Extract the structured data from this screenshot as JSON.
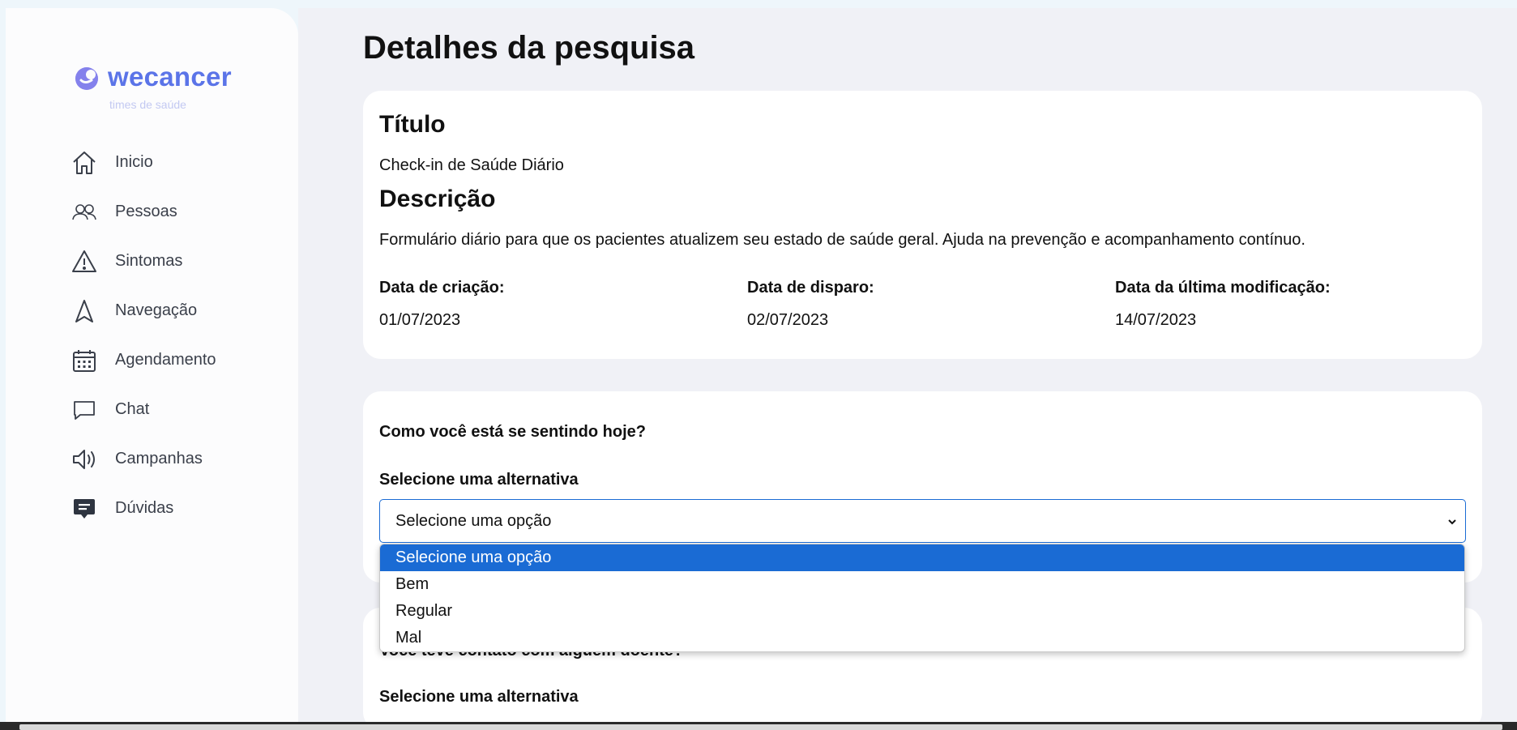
{
  "brand": {
    "name": "wecancer",
    "tagline": "times de saúde",
    "color": "#5b74e8"
  },
  "nav": {
    "items": [
      {
        "label": "Inicio",
        "icon": "home-icon"
      },
      {
        "label": "Pessoas",
        "icon": "people-icon"
      },
      {
        "label": "Sintomas",
        "icon": "warning-icon"
      },
      {
        "label": "Navegação",
        "icon": "navigation-arrow-icon"
      },
      {
        "label": "Agendamento",
        "icon": "calendar-icon"
      },
      {
        "label": "Chat",
        "icon": "chat-bubble-icon"
      },
      {
        "label": "Campanhas",
        "icon": "megaphone-icon"
      },
      {
        "label": "Dúvidas",
        "icon": "message-filled-icon"
      }
    ]
  },
  "page": {
    "title": "Detalhes da pesquisa"
  },
  "survey": {
    "title_heading": "Título",
    "title_value": "Check-in de Saúde Diário",
    "description_heading": "Descrição",
    "description_value": "Formulário diário para que os pacientes atualizem seu estado de saúde geral. Ajuda na prevenção e acompanhamento contínuo.",
    "created_label": "Data de criação:",
    "created_value": "01/07/2023",
    "sent_label": "Data de disparo:",
    "sent_value": "02/07/2023",
    "modified_label": "Data da última modificação:",
    "modified_value": "14/07/2023"
  },
  "questions": [
    {
      "question": "Como você está se sentindo hoje?",
      "select_label": "Selecione uma alternativa",
      "select_value": "Selecione uma opção",
      "options": [
        "Selecione uma opção",
        "Bem",
        "Regular",
        "Mal"
      ]
    },
    {
      "question": "Você teve contato com alguém doente?",
      "select_label": "Selecione uma alternativa"
    }
  ],
  "colors": {
    "select_border": "#1a6bd4",
    "selected_option_bg": "#1a6bd4"
  }
}
